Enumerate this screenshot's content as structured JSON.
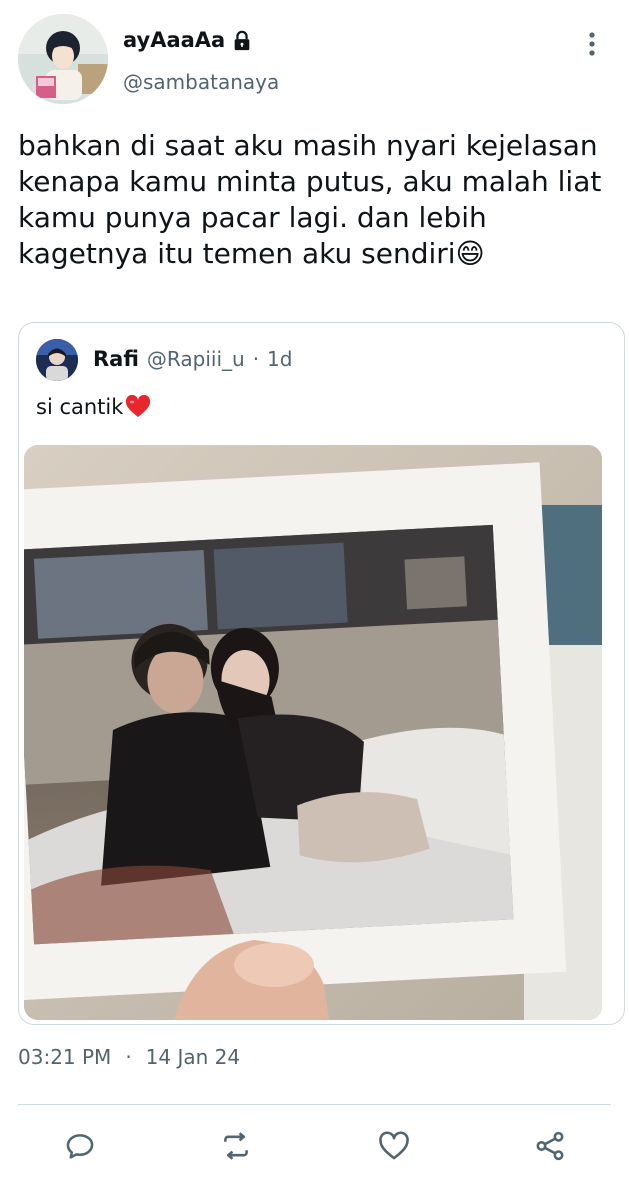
{
  "tweet": {
    "author": {
      "display_name": "ayAaaAa",
      "handle": "@sambatanaya",
      "protected_icon": "lock-icon"
    },
    "text": "bahkan di saat aku masih nyari kejelasan\nkenapa kamu minta putus, aku malah liat\nkamu punya pacar lagi. dan lebih\nkagetnya itu temen aku sendiri😄",
    "time": "03:21 PM",
    "separator": "·",
    "date": "14 Jan 24"
  },
  "quote": {
    "author": {
      "display_name": "Rafi",
      "handle": "@Rapiii_u",
      "separator": "·",
      "time": "1d"
    },
    "text": "si cantik",
    "emoji_icon": "red-heart-icon",
    "media_icon": "photo"
  },
  "actions": [
    {
      "name": "reply",
      "icon": "reply-icon"
    },
    {
      "name": "retweet",
      "icon": "retweet-icon"
    },
    {
      "name": "like",
      "icon": "heart-icon"
    },
    {
      "name": "share",
      "icon": "share-icon"
    }
  ],
  "colors": {
    "text_primary": "#0f1419",
    "text_secondary": "#536471",
    "border": "#cfd9de",
    "background": "#ffffff"
  }
}
